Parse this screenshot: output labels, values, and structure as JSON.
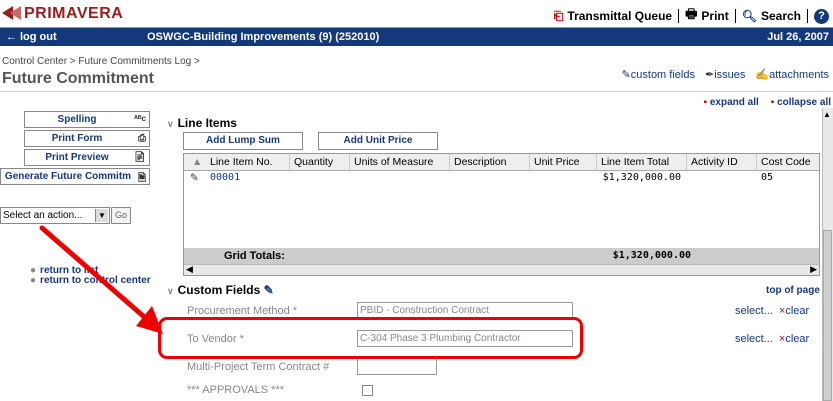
{
  "header": {
    "logo": "PRIMAVERA",
    "transmittal_queue": "Transmittal Queue",
    "print": "Print",
    "search": "Search",
    "help_icon": "?"
  },
  "navbar": {
    "logout": "log out",
    "project": "OSWGC-Building Improvements (9) (252010)",
    "date": "Jul 26, 2007"
  },
  "breadcrumb": "Control Center > Future Commitments Log >",
  "page_title": "Future Commitment",
  "page_links": {
    "custom_fields": "custom fields",
    "issues": "issues",
    "attachments": "attachments"
  },
  "expand_all": "expand all",
  "collapse_all": "collapse all",
  "sidebar": {
    "buttons": [
      {
        "label": "Spelling",
        "icon": "ABC"
      },
      {
        "label": "Print Form",
        "icon": "printer"
      },
      {
        "label": "Print Preview",
        "icon": "preview"
      },
      {
        "label": "Generate Future Commitm",
        "icon": "generate"
      }
    ],
    "action_select": "Select an action...",
    "go": "Go",
    "return_to_list": "return to list",
    "return_to_control_center": "return to control center"
  },
  "line_items": {
    "title": "Line Items",
    "add_lump_sum": "Add Lump Sum",
    "add_unit_price": "Add Unit Price",
    "columns": [
      "Line Item No.",
      "Quantity",
      "Units of Measure",
      "Description",
      "Unit Price",
      "Line Item Total",
      "Activity ID",
      "Cost Code"
    ],
    "rows": [
      {
        "line_item_no": "00001",
        "quantity": "",
        "units": "",
        "description": "",
        "unit_price": "",
        "total": "$1,320,000.00",
        "activity_id": "",
        "cost_code": "05"
      }
    ],
    "grid_totals_label": "Grid Totals:",
    "grid_totals_value": "$1,320,000.00"
  },
  "custom_fields": {
    "title": "Custom Fields",
    "top_of_page": "top of page",
    "fields": [
      {
        "label": "Procurement Method *",
        "value": "PBID - Construction Contract",
        "select": "select...",
        "clear": "clear"
      },
      {
        "label": "To Vendor *",
        "value": "C-304 Phase 3 Plumbing Contractor",
        "select": "select...",
        "clear": "clear"
      },
      {
        "label": "Multi-Project Term Contract #",
        "value": ""
      },
      {
        "label": "*** APPROVALS ***",
        "value": ""
      }
    ]
  },
  "colors": {
    "brand_red": "#9b1c1c",
    "nav_blue": "#15387a",
    "highlight_red": "#e00000"
  }
}
